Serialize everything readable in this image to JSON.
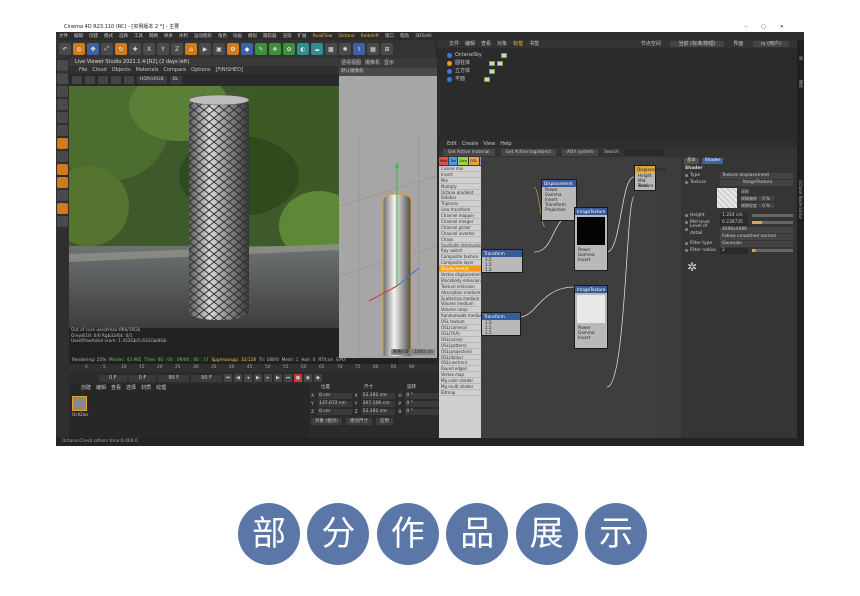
{
  "window": {
    "title": "Cinema 4D R23.110 (RC) - [实例版本 2 *] - 主要",
    "controls": [
      "–",
      "▢",
      "✕"
    ]
  },
  "menubar": [
    "文件",
    "编辑",
    "创建",
    "模式",
    "选择",
    "工具",
    "网格",
    "样条",
    "体积",
    "运动图形",
    "角色",
    "动画",
    "模拟",
    "跟踪器",
    "渲染",
    "扩展",
    "RealFlow",
    "Octane",
    "Redshift",
    "窗口",
    "帮助",
    "3DToAll"
  ],
  "live_viewer": {
    "title": "Live Viewer Studio 2021.1.4-[R2] (2 days left)",
    "menu": [
      "File",
      "Cloud",
      "Objects",
      "Materials",
      "Compare",
      "Options",
      "[FINISHED]"
    ],
    "color_mode": "HDR/sRGB",
    "render_mode": "DL",
    "stats": [
      "Out of core used/max:0Kb/16Gb",
      "Grey8/16: 0/0          Rgb32/64: 0/1",
      "Used/free/total vram: 1.452Gb/5.631Gb/8Gb"
    ],
    "render_status": {
      "progress": "Rendering: 25%",
      "ms": "Ms/sec: 43.965",
      "time": "Time: 00 : 00 : 09/00 : 00 : 37",
      "spp": "Spp/maxspp: 32/128",
      "tri": "Tri: 180/0",
      "mesh": "Mesh: 1",
      "hair": "Hair: 0",
      "rtx": "RTX:on",
      "gpu": "GPU:"
    }
  },
  "viewport": {
    "menu": [
      "透视视图",
      "摄像机",
      "显示"
    ],
    "camera": "默认摄像机",
    "footer": "网格间距 : 1000 cm"
  },
  "object_manager": {
    "menu": [
      "文件",
      "编辑",
      "查看",
      "对象",
      "标签",
      "书签"
    ],
    "right": [
      "节点空间",
      "当前 (标准/物理)",
      "界面",
      "rs (用户)"
    ],
    "objects": [
      {
        "name": "OctaneSky",
        "color": "#3c7bd6"
      },
      {
        "name": "圆柱体",
        "color": "#e89a2a"
      },
      {
        "name": "立方体",
        "color": "#3c7bd6"
      },
      {
        "name": "平面",
        "color": "#3c7bd6"
      }
    ]
  },
  "node_editor": {
    "menu": [
      "Edit",
      "Create",
      "View",
      "Help"
    ],
    "buttons": [
      "Get Active material",
      "Get Active tag/object",
      "AOV system"
    ],
    "search_label": "Search",
    "tabs": [
      {
        "label": "Mat",
        "color": "#e24c4c"
      },
      {
        "label": "Tex",
        "color": "#45a0e0"
      },
      {
        "label": "Gen",
        "color": "#9bd44a"
      },
      {
        "label": "OSL",
        "color": "#e0a545"
      },
      {
        "label": "Map",
        "color": "#c77ad8"
      },
      {
        "label": "Oth",
        "color": "#e8e8e8"
      },
      {
        "label": "Ems",
        "color": "#e8c84a"
      },
      {
        "label": "Med",
        "color": "#4ac8c8"
      },
      {
        "label": "C4D",
        "color": "#6c8ed8"
      }
    ],
    "node_list": [
      "Cosine mix",
      "Invert",
      "Mix",
      "Multiply",
      "Octane gradient",
      "Sidebar",
      "Triplanar",
      "Uvw transform",
      "Channel mapper",
      "Channel merger",
      "Channel picker",
      "Channel inverter",
      "Chaos",
      "Spotlight distribution",
      "Ray switch",
      "Composite texture",
      "Composite layer",
      "Displacement",
      "Vertex displacement",
      "Blackbody emission",
      "Texture emission",
      "Absorption medium",
      "Scattering medium",
      "Volume medium",
      "Volume ramp",
      "Randomwalk medium",
      "OSL texture",
      "OSL(camera)",
      "OSL(TAA)",
      "OSL(noise)",
      "OSL(pattern)",
      "OSL(projection)",
      "OSL(delay)",
      "OSL(vectron)",
      "Round edges",
      "Vertex map",
      "Mg color shader",
      "Mg multi shader",
      "Bitmap"
    ],
    "selected_node": "Displacement",
    "nodes": {
      "displacement": {
        "title": "Displacement",
        "rows": [
          "Power",
          "Gamma",
          "Invert",
          "Transform",
          "Projection"
        ]
      },
      "transform1": {
        "title": "Transform",
        "rows": [
          "1.5",
          "1.5",
          "1.5"
        ]
      },
      "imagetex1": {
        "title": "ImageTexture",
        "rows": [
          "Power",
          "Gamma",
          "Invert",
          "Transform",
          "Projection"
        ]
      },
      "transform2": {
        "title": "Transform",
        "rows": [
          "1.5",
          "1.5",
          "1.5"
        ]
      },
      "imagetex2": {
        "title": "ImageTexture",
        "rows": [
          "Power",
          "Gamma",
          "Invert",
          "Transform",
          "Projection"
        ]
      },
      "octane_disp": {
        "title": "Displacement",
        "rows": [
          "Height",
          "Mid level",
          "Texture"
        ]
      }
    }
  },
  "attributes": {
    "tabs": [
      "基本",
      "Shader"
    ],
    "section": "Shader",
    "type_label": "Type",
    "type_value": "Texture displacement",
    "texture_label": "Texture",
    "texture_value": "ImageTexture",
    "thumb_rows": [
      {
        "label": "采样",
        "value": ""
      },
      {
        "label": "模糊偏移",
        "value": "0 %"
      },
      {
        "label": "模糊程度",
        "value": "0 %"
      }
    ],
    "height_label": "Height",
    "height_value": "1.224 cm",
    "midlevel_label": "Mid level",
    "midlevel_value": "0.236735",
    "lod_label": "Level of detail",
    "lod_value": "4096x4096",
    "lod_sub": "Follow smoothed normal",
    "filter_label": "Filter type",
    "filter_value": "Gaussian",
    "radius_label": "Filter radius",
    "radius_value": "2"
  },
  "timeline": {
    "ticks": [
      "0",
      "5",
      "10",
      "15",
      "20",
      "25",
      "30",
      "35",
      "40",
      "45",
      "50",
      "55",
      "60",
      "65",
      "70",
      "75",
      "80",
      "85",
      "90"
    ],
    "start": "0 F",
    "mid": "0 F",
    "end": "90 F",
    "end2": "90 F",
    "current": "0 F"
  },
  "material_manager": {
    "menu": [
      "创建",
      "编辑",
      "查看",
      "选择",
      "材质",
      "纹理"
    ],
    "material_name": "OctGlos"
  },
  "coordinates": {
    "headers": [
      "位置",
      "尺寸",
      "旋转"
    ],
    "rows": [
      {
        "axis": "X",
        "pos": "0 cm",
        "size": "52.182 cm",
        "rk": "H",
        "rot": "0 °"
      },
      {
        "axis": "Y",
        "pos": "137.672 cm",
        "size": "267.106 cm",
        "rk": "P",
        "rot": "0 °"
      },
      {
        "axis": "Z",
        "pos": "0 cm",
        "size": "52.182 cm",
        "rk": "B",
        "rot": "0 °"
      }
    ],
    "buttons": [
      "对象 (相对)",
      "绝对尺寸",
      "应用"
    ]
  },
  "status_bar": "Octane:Check others time:0.069  0",
  "sidebar_right": [
    "Octane Node Editor",
    "属性",
    "层"
  ],
  "caption": [
    "部",
    "分",
    "作",
    "品",
    "展",
    "示"
  ],
  "colors": {
    "caption_circle": "#5b77a8",
    "accent_orange": "#f39c1a",
    "accent_blue": "#3d62a6"
  }
}
